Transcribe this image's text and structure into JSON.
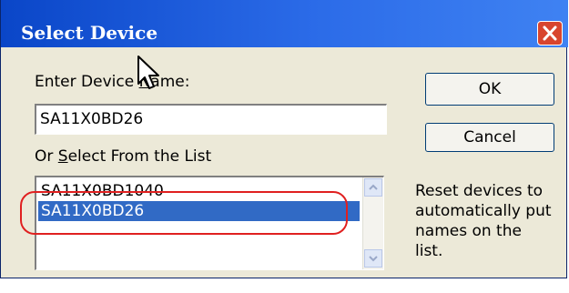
{
  "window": {
    "title": "Select Device",
    "close_icon": "close-x-icon"
  },
  "name_field": {
    "label_prefix": "Enter Device ",
    "label_underline": "N",
    "label_suffix": "ame:",
    "value": "SA11X0BD26"
  },
  "device_list": {
    "label_prefix": "Or ",
    "label_underline": "S",
    "label_suffix": "elect From the List",
    "items": [
      "SA11X0BD1040",
      "SA11X0BD26"
    ],
    "selected_index": 1
  },
  "buttons": {
    "ok": "OK",
    "cancel": "Cancel"
  },
  "note": {
    "lines": [
      "Reset devices to",
      "automatically put",
      "names on the",
      "list."
    ]
  },
  "colors": {
    "title_bar": "#0a46c8",
    "selection": "#316ac5",
    "annotation": "#e02020",
    "close_button": "#d8452e"
  }
}
